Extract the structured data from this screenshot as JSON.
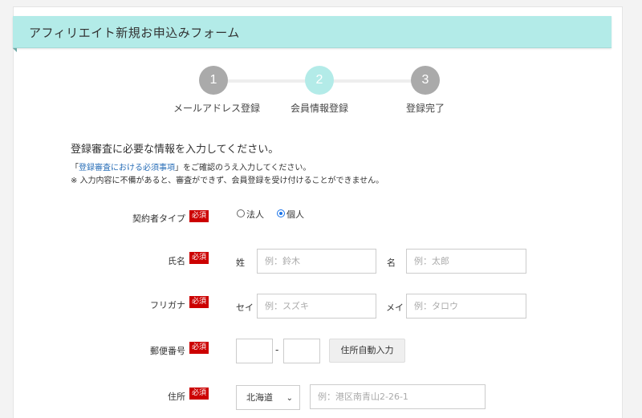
{
  "form": {
    "title": "アフィリエイト新規お申込みフォーム"
  },
  "steps": [
    {
      "number": "1",
      "label": "メールアドレス登録",
      "color": "#aaaaaa"
    },
    {
      "number": "2",
      "label": "会員情報登録",
      "color": "#b3ebe8"
    },
    {
      "number": "3",
      "label": "登録完了",
      "color": "#aaaaaa"
    }
  ],
  "active_step": 2,
  "intro": {
    "heading": "登録審査に必要な情報を入力してください。",
    "note_prefix": "「",
    "note_link": "登録審査における必須事項",
    "note_suffix": "」をご確認のうえ入力してください。",
    "note2": "※ 入力内容に不備があると、審査ができず、会員登録を受け付けることができません。"
  },
  "required_badge": "必須",
  "fields": {
    "contract_type": {
      "label": "契約者タイプ",
      "options": [
        "法人",
        "個人"
      ],
      "selected": "個人"
    },
    "name": {
      "label": "氏名",
      "last_label": "姓",
      "last_placeholder": "例：鈴木",
      "first_label": "名",
      "first_placeholder": "例：太郎"
    },
    "kana": {
      "label": "フリガナ",
      "last_label": "セイ",
      "last_placeholder": "例：スズキ",
      "first_label": "メイ",
      "first_placeholder": "例：タロウ"
    },
    "postal": {
      "label": "郵便番号",
      "separator": "-",
      "autofill_button": "住所自動入力"
    },
    "address": {
      "label": "住所",
      "prefecture_selected": "北海道",
      "address_placeholder": "例：港区南青山2-26-1"
    }
  }
}
